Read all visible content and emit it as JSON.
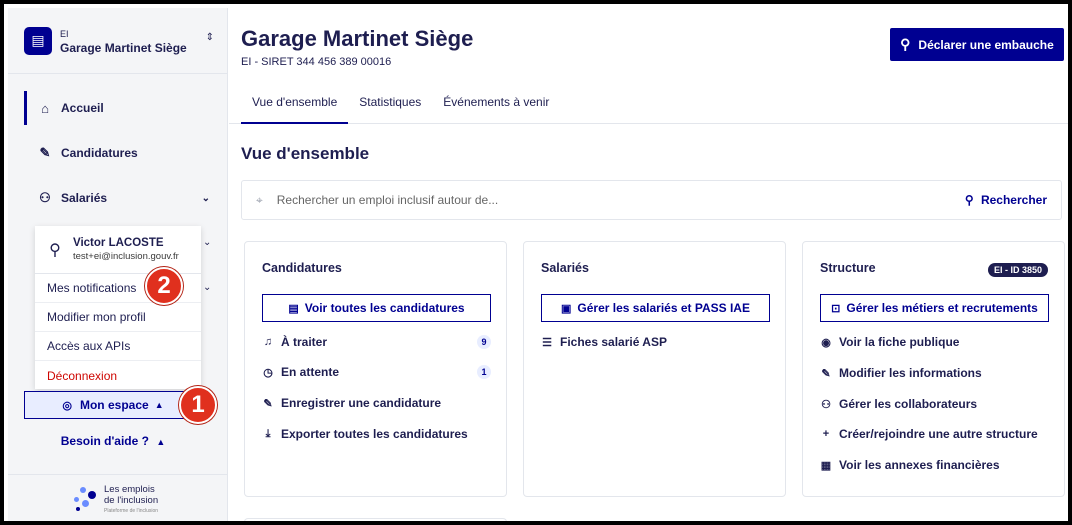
{
  "org": {
    "type": "EI",
    "name": "Garage Martinet Siège"
  },
  "nav": {
    "home": "Accueil",
    "applications": "Candidatures",
    "employees": "Salariés"
  },
  "user": {
    "name": "Victor LACOSTE",
    "email": "test+ei@inclusion.gouv.fr"
  },
  "user_menu": [
    "Mes notifications",
    "Modifier mon profil",
    "Accès aux APIs",
    "Déconnexion"
  ],
  "my_space": "Mon espace",
  "help": "Besoin d'aide ?",
  "brand": {
    "line1": "Les emplois",
    "line2": "de l'inclusion",
    "tagline": "Plateforme de l'inclusion"
  },
  "annotations": [
    "1",
    "2"
  ],
  "header": {
    "title": "Garage Martinet Siège",
    "subtitle": "EI - SIRET 344 456 389 00016",
    "hire_button": "Déclarer une embauche"
  },
  "tabs": [
    "Vue d'ensemble",
    "Statistiques",
    "Événements à venir"
  ],
  "section_title": "Vue d'ensemble",
  "search": {
    "placeholder": "Rechercher un emploi inclusif autour de...",
    "button": "Rechercher"
  },
  "cards": {
    "applications": {
      "title": "Candidatures",
      "button": "Voir toutes les candidatures",
      "links": [
        {
          "label": "À traiter",
          "count": "9"
        },
        {
          "label": "En attente",
          "count": "1"
        },
        {
          "label": "Enregistrer une candidature"
        },
        {
          "label": "Exporter toutes les candidatures"
        }
      ]
    },
    "employees": {
      "title": "Salariés",
      "button": "Gérer les salariés et PASS IAE",
      "links": [
        {
          "label": "Fiches salarié ASP"
        }
      ]
    },
    "structure": {
      "title": "Structure",
      "tag": "EI - ID 3850",
      "button": "Gérer les métiers et recrutements",
      "links": [
        {
          "label": "Voir la fiche publique"
        },
        {
          "label": "Modifier les informations"
        },
        {
          "label": "Gérer les collaborateurs"
        },
        {
          "label": "Créer/rejoindre une autre structure"
        },
        {
          "label": "Voir les annexes financières"
        }
      ]
    }
  }
}
